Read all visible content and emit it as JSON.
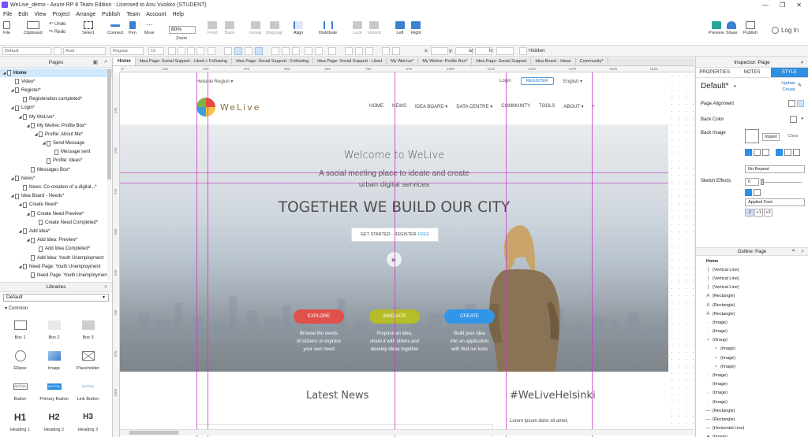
{
  "window": {
    "title": "WeLive_demo - Axure RP 8 Team Edition : Licensed to Anu Vuokko (STUDENT)",
    "min": "—",
    "max": "❐",
    "close": "✕"
  },
  "menu": [
    "File",
    "Edit",
    "View",
    "Project",
    "Arrange",
    "Publish",
    "Team",
    "Account",
    "Help"
  ],
  "toolbar": {
    "file": "File",
    "clipboard": "Clipboard",
    "undo": "Undo",
    "redo": "Redo",
    "select": "Select",
    "connect": "Connect",
    "pen": "Pen",
    "more": "More",
    "zoom_value": "80%",
    "zoom": "Zoom",
    "front": "Front",
    "back": "Back",
    "group": "Group",
    "ungroup": "Ungroup",
    "align": "Align",
    "distribute": "Distribute",
    "lock": "Lock",
    "unlock": "Unlock",
    "left": "Left",
    "right": "Right",
    "preview": "Preview",
    "share": "Share",
    "publish": "Publish",
    "login": "Log In"
  },
  "format": {
    "style": "Default",
    "font": "Arial",
    "weight": "Regular",
    "size": "13",
    "x": "x:",
    "y": "y:",
    "w": "w:",
    "h": "h:",
    "hidden": "Hidden"
  },
  "pages_panel": {
    "title": "Pages",
    "items": [
      {
        "label": "Home",
        "level": 0,
        "expand": "◢",
        "selected": true
      },
      {
        "label": "Video*",
        "level": 1
      },
      {
        "label": "Register*",
        "level": 1,
        "expand": "◢"
      },
      {
        "label": "Registeration completed*",
        "level": 2
      },
      {
        "label": "Login*",
        "level": 1,
        "expand": "◢"
      },
      {
        "label": "My WeLive*",
        "level": 2,
        "expand": "◢"
      },
      {
        "label": "My Welive: Profile Box*",
        "level": 3,
        "expand": "◢"
      },
      {
        "label": "Profile: About Me*",
        "level": 4,
        "expand": "◢"
      },
      {
        "label": "Send Message",
        "level": 5,
        "expand": "◢"
      },
      {
        "label": "Message sent",
        "level": 6
      },
      {
        "label": "Profile: Ideas*",
        "level": 5
      },
      {
        "label": "Messages Box*",
        "level": 3
      },
      {
        "label": "News*",
        "level": 1,
        "expand": "◢"
      },
      {
        "label": "News: Co-creation of a digital...*",
        "level": 2
      },
      {
        "label": "Idea Board - Needs*",
        "level": 1,
        "expand": "◢"
      },
      {
        "label": "Create Need*",
        "level": 2,
        "expand": "◢"
      },
      {
        "label": "Create Need Preview*",
        "level": 3,
        "expand": "◢"
      },
      {
        "label": "Create Need Completed*",
        "level": 4
      },
      {
        "label": "Add Idea*",
        "level": 2,
        "expand": "◢"
      },
      {
        "label": "Add Idea: Preview*",
        "level": 3,
        "expand": "◢"
      },
      {
        "label": "Add Idea Completed*",
        "level": 4
      },
      {
        "label": "Add Idea: Youth Unemployment",
        "level": 3
      },
      {
        "label": "Need Page: Youth Unemployment",
        "level": 2,
        "expand": "◢"
      },
      {
        "label": "Need Page: Youth Unemployment",
        "level": 3
      }
    ]
  },
  "libraries": {
    "title": "Libraries",
    "selected": "Default",
    "section": "Common",
    "items": [
      "Box 1",
      "Box 2",
      "Box 3",
      "Ellipse",
      "Image",
      "Placeholder",
      "Button",
      "Primary Button",
      "Link Button",
      "Heading 1",
      "Heading 2",
      "Heading 3"
    ],
    "glyphs": {
      "button": "BUTTON",
      "primary": "BUTTON",
      "link": "BUTTON",
      "h1": "H1",
      "h2": "H2",
      "h3": "H3"
    }
  },
  "tabs": [
    "Home",
    "Idea Page: Social Support - Liked + Following",
    "Idea Page: Social Support - Following",
    "Idea Page: Social Support - Liked",
    "My WeLive*",
    "My Welive: Profile Box*",
    "Idea Page: Social Support",
    "Idea Board - Ideas",
    "Community*"
  ],
  "ruler_h": [
    "0",
    "125",
    "250",
    "375",
    "500",
    "625",
    "750",
    "875",
    "1000",
    "1125",
    "1250",
    "1375",
    "1500",
    "1625"
  ],
  "ruler_v": [
    "125",
    "250",
    "375",
    "500",
    "625",
    "750",
    "875",
    "1000"
  ],
  "site": {
    "region": "Helsinki Region",
    "login": "Login",
    "register": "REGISTER",
    "language": "English",
    "logo": "WeLive",
    "nav": [
      "HOME",
      "NEWS",
      "IDEA BOARD",
      "DATA CENTRE",
      "COMMUNITY",
      "TOOLS",
      "ABOUT"
    ],
    "welcome": "Welcome to WeLive",
    "tagline1": "A social meeting place to ideate and create",
    "tagline2": "urban digital services",
    "headline": "TOGETHER WE BUILD OUR CITY",
    "cta": "GET STARTED - REGISTER",
    "cta_free": "FREE",
    "pills": [
      {
        "label": "EXPLORE",
        "color": "#e0514d",
        "text": [
          "Browse the needs",
          "of citizens or express",
          "your own need"
        ]
      },
      {
        "label": "INNOVATE",
        "color": "#b5bd27",
        "text": [
          "Propose an idea,",
          "share it with others and",
          "develop ideas together"
        ]
      },
      {
        "label": "CREATE",
        "color": "#3195e8",
        "text": [
          "Build your idea",
          "into an application",
          "with WeLive tools"
        ]
      }
    ],
    "latest_news": "Latest News",
    "hashtag": "#WeLiveHelsinki",
    "lorem": "Lorem ipsum dolor sit amet,"
  },
  "inspector": {
    "title": "Inspector: Page",
    "tabs": [
      "PROPERTIES",
      "NOTES",
      "STYLE"
    ],
    "active_tab": "STYLE",
    "name": "Default*",
    "update": "Update",
    "create": "Create",
    "page_alignment": "Page Alignment",
    "back_color": "Back Color",
    "back_image": "Back Image",
    "import": "Import",
    "clear": "Clear",
    "repeat": "No Repeat",
    "sketch_effects": "Sketch Effects",
    "sketch_value": "0",
    "applied_font": "Applied Font",
    "font_btns": [
      "-2",
      "+1",
      "+2"
    ]
  },
  "outline": {
    "title": "Outline: Page",
    "items": [
      {
        "label": "Home",
        "icon": "",
        "bold": true
      },
      {
        "label": "(Vertical Line)",
        "icon": "|"
      },
      {
        "label": "(Vertical Line)",
        "icon": "|"
      },
      {
        "label": "(Vertical Line)",
        "icon": "|"
      },
      {
        "label": "(Rectangle)",
        "icon": "A"
      },
      {
        "label": "(Rectangle)",
        "icon": "A"
      },
      {
        "label": "(Rectangle)",
        "icon": "A"
      },
      {
        "label": "(Image)",
        "icon": "·"
      },
      {
        "label": "(Image)",
        "icon": "·"
      },
      {
        "label": "(Group)",
        "icon": "▪"
      },
      {
        "label": "(Image)",
        "icon": "▪"
      },
      {
        "label": "(Image)",
        "icon": "▪"
      },
      {
        "label": "(Image)",
        "icon": "▪"
      },
      {
        "label": "(Image)",
        "icon": "·"
      },
      {
        "label": "(Image)",
        "icon": "·"
      },
      {
        "label": "(Image)",
        "icon": "·"
      },
      {
        "label": "(Image)",
        "icon": "·"
      },
      {
        "label": "(Rectangle)",
        "icon": "—"
      },
      {
        "label": "(Rectangle)",
        "icon": "—"
      },
      {
        "label": "(Horizontal Line)",
        "icon": "—"
      },
      {
        "label": "(Image)",
        "icon": "●"
      }
    ]
  }
}
